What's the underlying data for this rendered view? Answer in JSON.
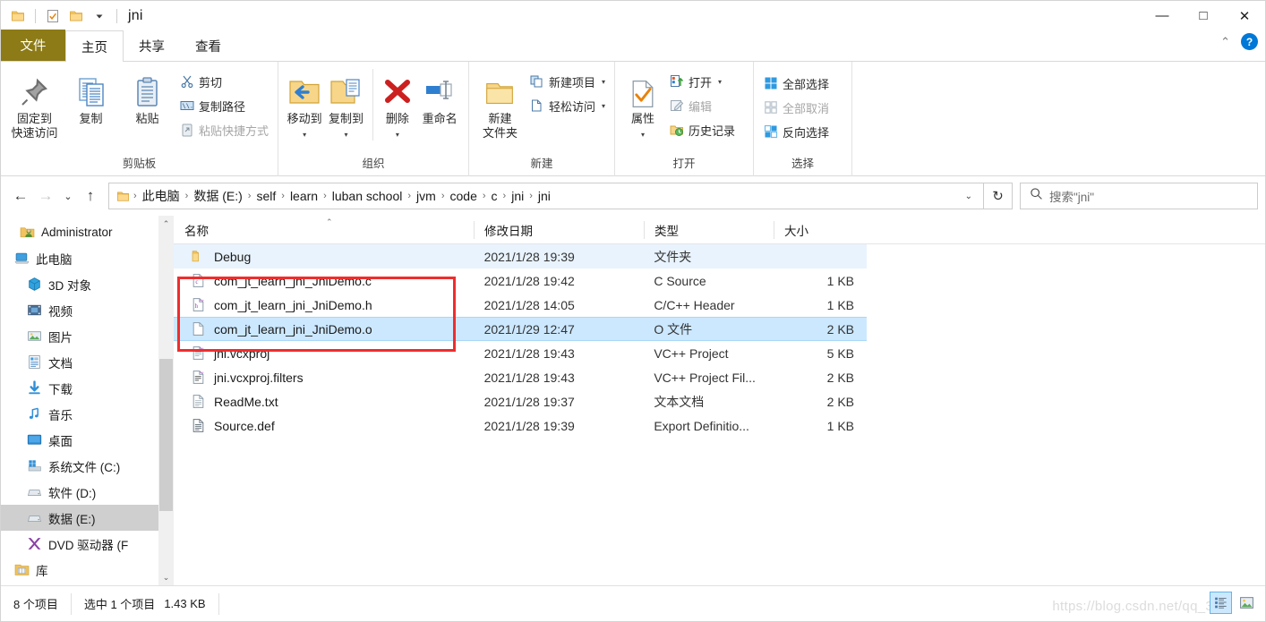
{
  "window": {
    "title": "jni",
    "quick_access": [
      {
        "name": "folder-icon",
        "label": "folder"
      },
      {
        "name": "properties-check-icon",
        "label": "properties"
      },
      {
        "name": "new-folder-icon",
        "label": "new folder"
      },
      {
        "name": "customize-caret-icon",
        "label": "customize"
      }
    ],
    "controls": {
      "minimize": "—",
      "maximize": "□",
      "close": "✕"
    }
  },
  "tabs": [
    {
      "label": "文件",
      "id": "file"
    },
    {
      "label": "主页",
      "id": "home"
    },
    {
      "label": "共享",
      "id": "share"
    },
    {
      "label": "查看",
      "id": "view"
    }
  ],
  "ribbon": {
    "collapse_caret": "⌃",
    "help_label": "?",
    "groups": [
      {
        "id": "clipboard",
        "label": "剪贴板",
        "big_buttons": [
          {
            "label_line1": "固定到",
            "label_line2": "快速访问",
            "icon": "pin-icon",
            "disabled": false
          },
          {
            "label_line1": "复制",
            "label_line2": "",
            "icon": "copy-icon",
            "disabled": false
          },
          {
            "label_line1": "粘贴",
            "label_line2": "",
            "icon": "paste-icon",
            "disabled": false
          }
        ],
        "small_buttons": [
          {
            "label": "剪切",
            "icon": "scissors-icon",
            "disabled": false
          },
          {
            "label": "复制路径",
            "icon": "copy-path-icon",
            "disabled": false
          },
          {
            "label": "粘贴快捷方式",
            "icon": "paste-shortcut-icon",
            "disabled": true
          }
        ]
      },
      {
        "id": "organize",
        "label": "组织",
        "big_buttons": [
          {
            "label_line1": "移动到",
            "label_line2": "",
            "icon": "move-to-icon",
            "has_caret": true,
            "disabled": false
          },
          {
            "label_line1": "复制到",
            "label_line2": "",
            "icon": "copy-to-icon",
            "has_caret": true,
            "disabled": false
          },
          {
            "label_line1": "删除",
            "label_line2": "",
            "icon": "delete-icon",
            "has_caret": true,
            "disabled": false
          },
          {
            "label_line1": "重命名",
            "label_line2": "",
            "icon": "rename-icon",
            "has_caret": false,
            "disabled": false
          }
        ],
        "small_buttons": []
      },
      {
        "id": "new",
        "label": "新建",
        "big_buttons": [
          {
            "label_line1": "新建",
            "label_line2": "文件夹",
            "icon": "new-folder-icon",
            "disabled": false
          }
        ],
        "small_buttons": [
          {
            "label": "新建项目",
            "icon": "new-item-icon",
            "has_caret": true,
            "disabled": false
          },
          {
            "label": "轻松访问",
            "icon": "easy-access-icon",
            "has_caret": true,
            "disabled": false
          }
        ]
      },
      {
        "id": "open",
        "label": "打开",
        "big_buttons": [
          {
            "label_line1": "属性",
            "label_line2": "",
            "icon": "properties-icon",
            "has_caret": true,
            "disabled": false
          }
        ],
        "small_buttons": [
          {
            "label": "打开",
            "icon": "open-icon",
            "has_caret": true,
            "disabled": false
          },
          {
            "label": "编辑",
            "icon": "edit-icon",
            "has_caret": false,
            "disabled": true
          },
          {
            "label": "历史记录",
            "icon": "history-icon",
            "has_caret": false,
            "disabled": false
          }
        ]
      },
      {
        "id": "select",
        "label": "选择",
        "big_buttons": [],
        "small_buttons": [
          {
            "label": "全部选择",
            "icon": "select-all-icon",
            "disabled": false
          },
          {
            "label": "全部取消",
            "icon": "select-none-icon",
            "disabled": true
          },
          {
            "label": "反向选择",
            "icon": "invert-selection-icon",
            "disabled": false
          }
        ]
      }
    ]
  },
  "address": {
    "back": "←",
    "forward": "→",
    "recent_caret": "⌄",
    "up": "↑",
    "refresh": "↻",
    "breadcrumbs": [
      "此电脑",
      "数据 (E:)",
      "self",
      "learn",
      "luban school",
      "jvm",
      "code",
      "c",
      "jni",
      "jni"
    ],
    "separator": "›",
    "dropdown_caret": "⌄"
  },
  "search": {
    "placeholder": "搜索\"jni\"",
    "icon": "search-icon"
  },
  "sidebar": {
    "items": [
      {
        "label": "Administrator",
        "icon": "user-folder-icon",
        "indent": 20,
        "selected": false
      },
      {
        "label": "此电脑",
        "icon": "this-pc-icon",
        "indent": 14,
        "selected": false
      },
      {
        "label": "3D 对象",
        "icon": "3d-objects-icon",
        "indent": 28,
        "selected": false
      },
      {
        "label": "视频",
        "icon": "videos-icon",
        "indent": 28,
        "selected": false
      },
      {
        "label": "图片",
        "icon": "pictures-icon",
        "indent": 28,
        "selected": false
      },
      {
        "label": "文档",
        "icon": "documents-icon",
        "indent": 28,
        "selected": false
      },
      {
        "label": "下载",
        "icon": "downloads-icon",
        "indent": 28,
        "selected": false
      },
      {
        "label": "音乐",
        "icon": "music-icon",
        "indent": 28,
        "selected": false
      },
      {
        "label": "桌面",
        "icon": "desktop-icon",
        "indent": 28,
        "selected": false
      },
      {
        "label": "系统文件 (C:)",
        "icon": "system-drive-icon",
        "indent": 28,
        "selected": false
      },
      {
        "label": "软件 (D:)",
        "icon": "drive-icon",
        "indent": 28,
        "selected": false
      },
      {
        "label": "数据 (E:)",
        "icon": "drive-icon",
        "indent": 28,
        "selected": true
      },
      {
        "label": "DVD 驱动器 (F",
        "icon": "dvd-drive-icon",
        "indent": 28,
        "selected": false
      },
      {
        "label": "库",
        "icon": "library-icon",
        "indent": 14,
        "selected": false
      }
    ],
    "scroll_up": "⌃",
    "scroll_down": "⌄"
  },
  "filelist": {
    "columns": [
      {
        "label": "名称",
        "key": "name"
      },
      {
        "label": "修改日期",
        "key": "date"
      },
      {
        "label": "类型",
        "key": "type"
      },
      {
        "label": "大小",
        "key": "size"
      }
    ],
    "sort_indicator": "⌃",
    "rows": [
      {
        "name": "Debug",
        "date": "2021/1/28 19:39",
        "type": "文件夹",
        "size": "",
        "icon": "folder-icon",
        "state": "hover"
      },
      {
        "name": "com_jt_learn_jni_JniDemo.c",
        "date": "2021/1/28 19:42",
        "type": "C Source",
        "size": "1 KB",
        "icon": "c-source-icon",
        "state": "none"
      },
      {
        "name": "com_jt_learn_jni_JniDemo.h",
        "date": "2021/1/28 14:05",
        "type": "C/C++ Header",
        "size": "1 KB",
        "icon": "c-header-icon",
        "state": "none"
      },
      {
        "name": "com_jt_learn_jni_JniDemo.o",
        "date": "2021/1/29 12:47",
        "type": "O 文件",
        "size": "2 KB",
        "icon": "generic-file-icon",
        "state": "selected"
      },
      {
        "name": "jni.vcxproj",
        "date": "2021/1/28 19:43",
        "type": "VC++ Project",
        "size": "5 KB",
        "icon": "vcxproj-icon",
        "state": "none"
      },
      {
        "name": "jni.vcxproj.filters",
        "date": "2021/1/28 19:43",
        "type": "VC++ Project Fil...",
        "size": "2 KB",
        "icon": "vcxproj-filters-icon",
        "state": "none"
      },
      {
        "name": "ReadMe.txt",
        "date": "2021/1/28 19:37",
        "type": "文本文档",
        "size": "2 KB",
        "icon": "text-file-icon",
        "state": "none"
      },
      {
        "name": "Source.def",
        "date": "2021/1/28 19:39",
        "type": "Export Definitio...",
        "size": "1 KB",
        "icon": "def-file-icon",
        "state": "none"
      }
    ],
    "annotation_box_color": "#f02d2d"
  },
  "statusbar": {
    "item_count": "8 个项目",
    "selection": "选中 1 个项目",
    "selection_size": "1.43 KB",
    "watermark": "https://blog.csdn.net/qq_3",
    "views": [
      {
        "name": "details-view-button",
        "active": true
      },
      {
        "name": "large-icons-view-button",
        "active": false
      }
    ]
  }
}
